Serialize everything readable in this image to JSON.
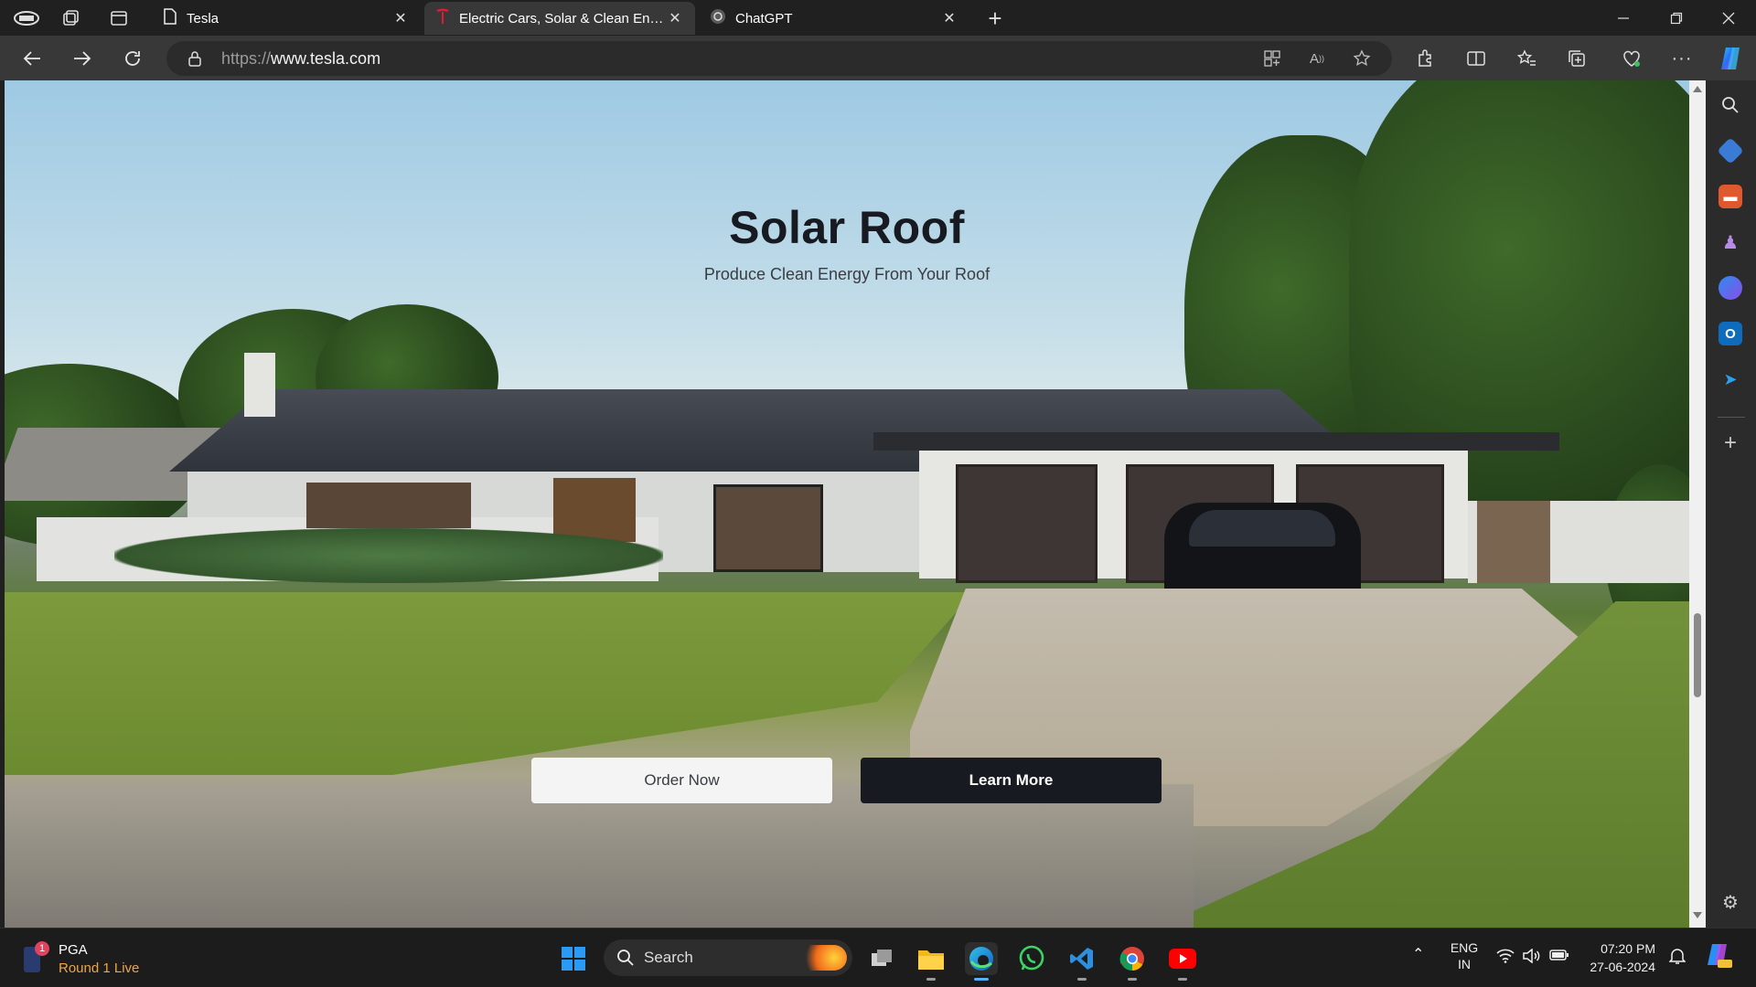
{
  "browser": {
    "tabs": [
      {
        "title": "Tesla",
        "active": false
      },
      {
        "title": "Electric Cars, Solar & Clean Energ",
        "active": true
      },
      {
        "title": "ChatGPT",
        "active": false
      }
    ],
    "url_prefix": "https://",
    "url_domain": "www.tesla.com",
    "accent_color": "#383838"
  },
  "hero": {
    "title": "Solar Roof",
    "subtitle": "Produce Clean Energy From Your Roof",
    "order_label": "Order Now",
    "learn_label": "Learn More"
  },
  "taskbar": {
    "widget_title": "PGA",
    "widget_sub": "Round 1 Live",
    "widget_badge": "1",
    "search_label": "Search",
    "lang_top": "ENG",
    "lang_bottom": "IN",
    "time": "07:20 PM",
    "date": "27-06-2024"
  }
}
